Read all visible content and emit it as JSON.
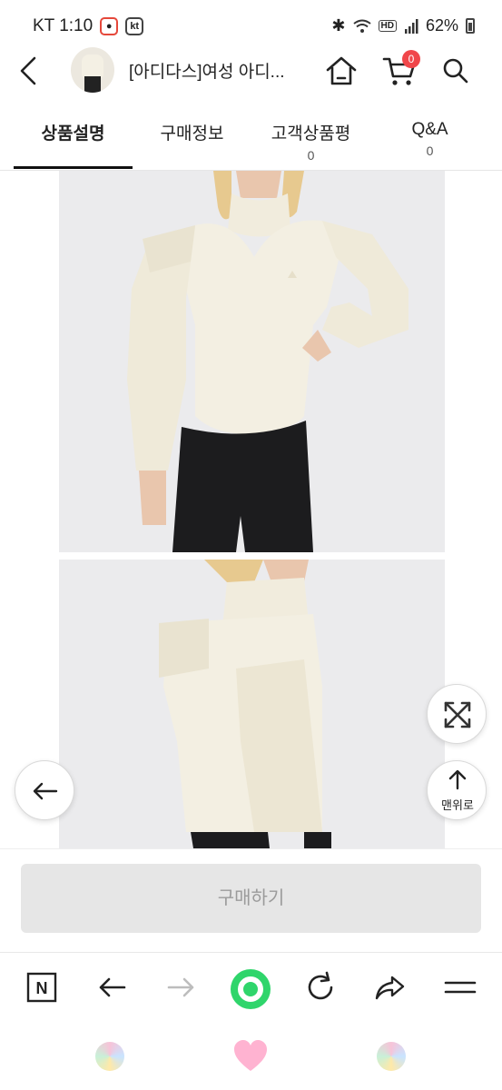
{
  "status_bar": {
    "carrier_time": "KT 1:10",
    "kt_badge": "kt",
    "hd_badge": "HD",
    "battery": "62%",
    "icons": [
      "location-pin-icon",
      "kt-badge-icon",
      "bluetooth-icon",
      "wifi-icon",
      "hd-icon",
      "signal-icon",
      "battery-icon"
    ]
  },
  "header": {
    "title": "[아디다스]여성 아디...",
    "cart_count": "0",
    "icons": [
      "back-arrow-icon",
      "home-icon",
      "cart-icon",
      "search-icon"
    ]
  },
  "tabs": [
    {
      "label": "상품설명",
      "count": "",
      "active": true
    },
    {
      "label": "구매정보",
      "count": "",
      "active": false
    },
    {
      "label": "고객상품평",
      "count": "0",
      "active": false
    },
    {
      "label": "Q&A",
      "count": "0",
      "active": false
    }
  ],
  "floating": {
    "top_label": "맨위로",
    "icons": [
      "expand-icon",
      "arrow-up-icon",
      "arrow-left-icon"
    ]
  },
  "buy": {
    "label": "구매하기"
  },
  "browser_bar": {
    "n_label": "N",
    "icons": [
      "naver-n-icon",
      "back-icon",
      "forward-icon",
      "green-dot-icon",
      "refresh-icon",
      "share-icon",
      "menu-icon"
    ]
  },
  "dock": {
    "icons": [
      "rainbow-ball-icon",
      "heart-icon",
      "rainbow-ball-icon"
    ]
  },
  "colors": {
    "badge_red": "#f0464a",
    "green_dot": "#2fd56b",
    "sweater": "#f3efe2",
    "pants": "#1c1c1e",
    "heart_pink": "#ffb3d1"
  }
}
